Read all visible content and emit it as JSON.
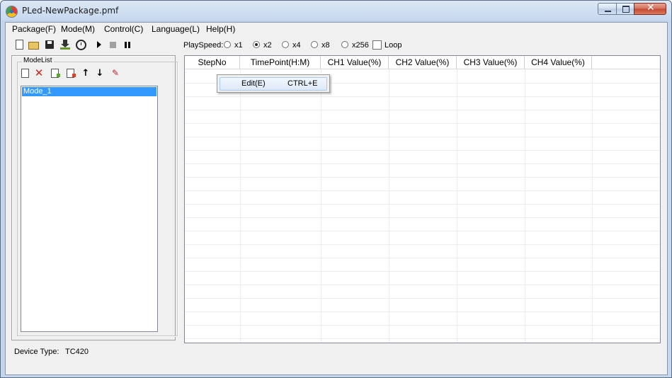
{
  "window": {
    "title": "PLed-NewPackage.pmf"
  },
  "menubar": {
    "items": [
      {
        "label": "Package(F)"
      },
      {
        "label": "Mode(M)"
      },
      {
        "label": "Control(C)"
      },
      {
        "label": "Language(L)"
      },
      {
        "label": "Help(H)"
      }
    ]
  },
  "toolbar": {
    "icons": [
      "new-file-icon",
      "open-folder-icon",
      "save-icon",
      "download-icon",
      "clock-icon",
      "play-icon",
      "stop-icon",
      "pause-icon"
    ]
  },
  "playspeed": {
    "label": "PlaySpeed:",
    "options": [
      {
        "label": "x1",
        "selected": false
      },
      {
        "label": "x2",
        "selected": true
      },
      {
        "label": "x4",
        "selected": false
      },
      {
        "label": "x8",
        "selected": false
      },
      {
        "label": "x256",
        "selected": false
      }
    ],
    "loop_label": "Loop",
    "loop_checked": false
  },
  "modelist": {
    "title": "ModeList",
    "icons": [
      "add-mode-icon",
      "delete-mode-icon",
      "import-mode-icon",
      "export-mode-icon",
      "move-up-icon",
      "move-down-icon",
      "edit-mode-icon"
    ],
    "items": [
      {
        "label": "Mode_1",
        "selected": true
      }
    ]
  },
  "grid": {
    "columns": [
      "StepNo",
      "TimePoint(H:M)",
      "CH1 Value(%)",
      "CH2 Value(%)",
      "CH3 Value(%)",
      "CH4 Value(%)"
    ],
    "rows": []
  },
  "context_menu": {
    "items": [
      {
        "label": "Edit(E)",
        "shortcut": "CTRL+E"
      }
    ]
  },
  "status": {
    "label": "Device Type:",
    "value": "TC420"
  },
  "colors": {
    "selection": "#3399ff",
    "titlebar": "#c5d6ec",
    "close_button": "#c4472f"
  }
}
